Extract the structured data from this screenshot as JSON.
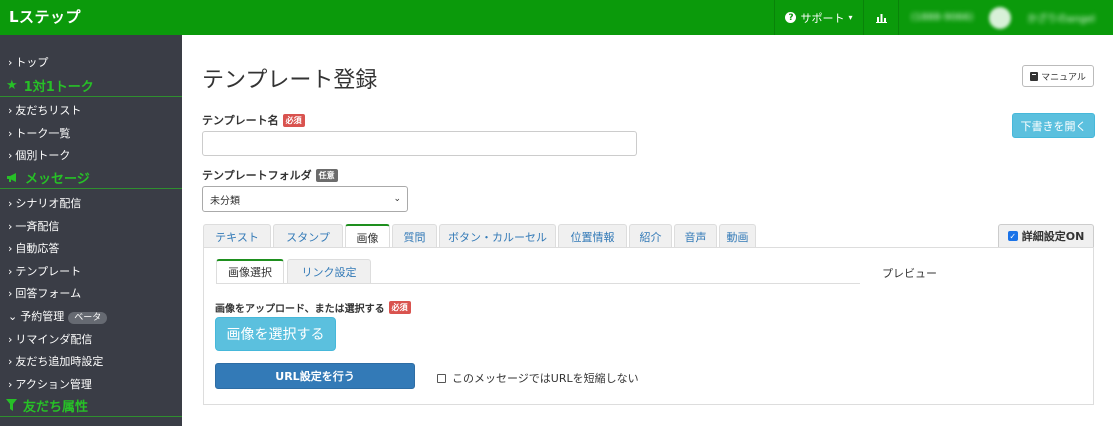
{
  "header": {
    "logo": "Lステップ",
    "support_label": "サポート",
    "account_id": "(1888-9066)",
    "account_name": "かざりのangel"
  },
  "sidebar": {
    "items": [
      {
        "label": "トップ",
        "type": "item"
      },
      {
        "label": "1対1トーク",
        "type": "section",
        "icon": "star-icon"
      },
      {
        "label": "友だちリスト",
        "type": "item"
      },
      {
        "label": "トーク一覧",
        "type": "item"
      },
      {
        "label": "個別トーク",
        "type": "item"
      },
      {
        "label": "メッセージ",
        "type": "section",
        "icon": "megaphone-icon"
      },
      {
        "label": "シナリオ配信",
        "type": "item"
      },
      {
        "label": "一斉配信",
        "type": "item"
      },
      {
        "label": "自動応答",
        "type": "item"
      },
      {
        "label": "テンプレート",
        "type": "item"
      },
      {
        "label": "回答フォーム",
        "type": "item"
      },
      {
        "label": "予約管理",
        "type": "item",
        "badge": "ベータ"
      },
      {
        "label": "リマインダ配信",
        "type": "item"
      },
      {
        "label": "友だち追加時設定",
        "type": "item"
      },
      {
        "label": "アクション管理",
        "type": "item"
      },
      {
        "label": "友だち属性",
        "type": "section",
        "icon": "filter-icon"
      }
    ]
  },
  "main": {
    "title": "テンプレート登録",
    "manual_label": "マニュアル",
    "draft_label": "下書きを開く",
    "name_label": "テンプレート名",
    "required_badge": "必須",
    "optional_badge": "任意",
    "name_value": "",
    "folder_label": "テンプレートフォルダ",
    "folder_value": "未分類",
    "tabs": [
      "テキスト",
      "スタンプ",
      "画像",
      "質問",
      "ボタン・カルーセル",
      "位置情報",
      "紹介",
      "音声",
      "動画"
    ],
    "active_tab": "画像",
    "detail_toggle": "詳細設定ON",
    "subtabs": [
      "画像選択",
      "リンク設定"
    ],
    "preview_label": "プレビュー",
    "upload_label": "画像をアップロード、または選択する",
    "select_image_button": "画像を選択する",
    "url_button": "URL設定を行う",
    "no_shorten_label": "このメッセージではURLを短縮しない"
  },
  "colors": {
    "brand_green": "#0b9a0b",
    "sidebar_bg": "#3a3d46",
    "info_blue": "#5bc0de",
    "primary_blue": "#337ab7",
    "danger_red": "#d9534f"
  }
}
